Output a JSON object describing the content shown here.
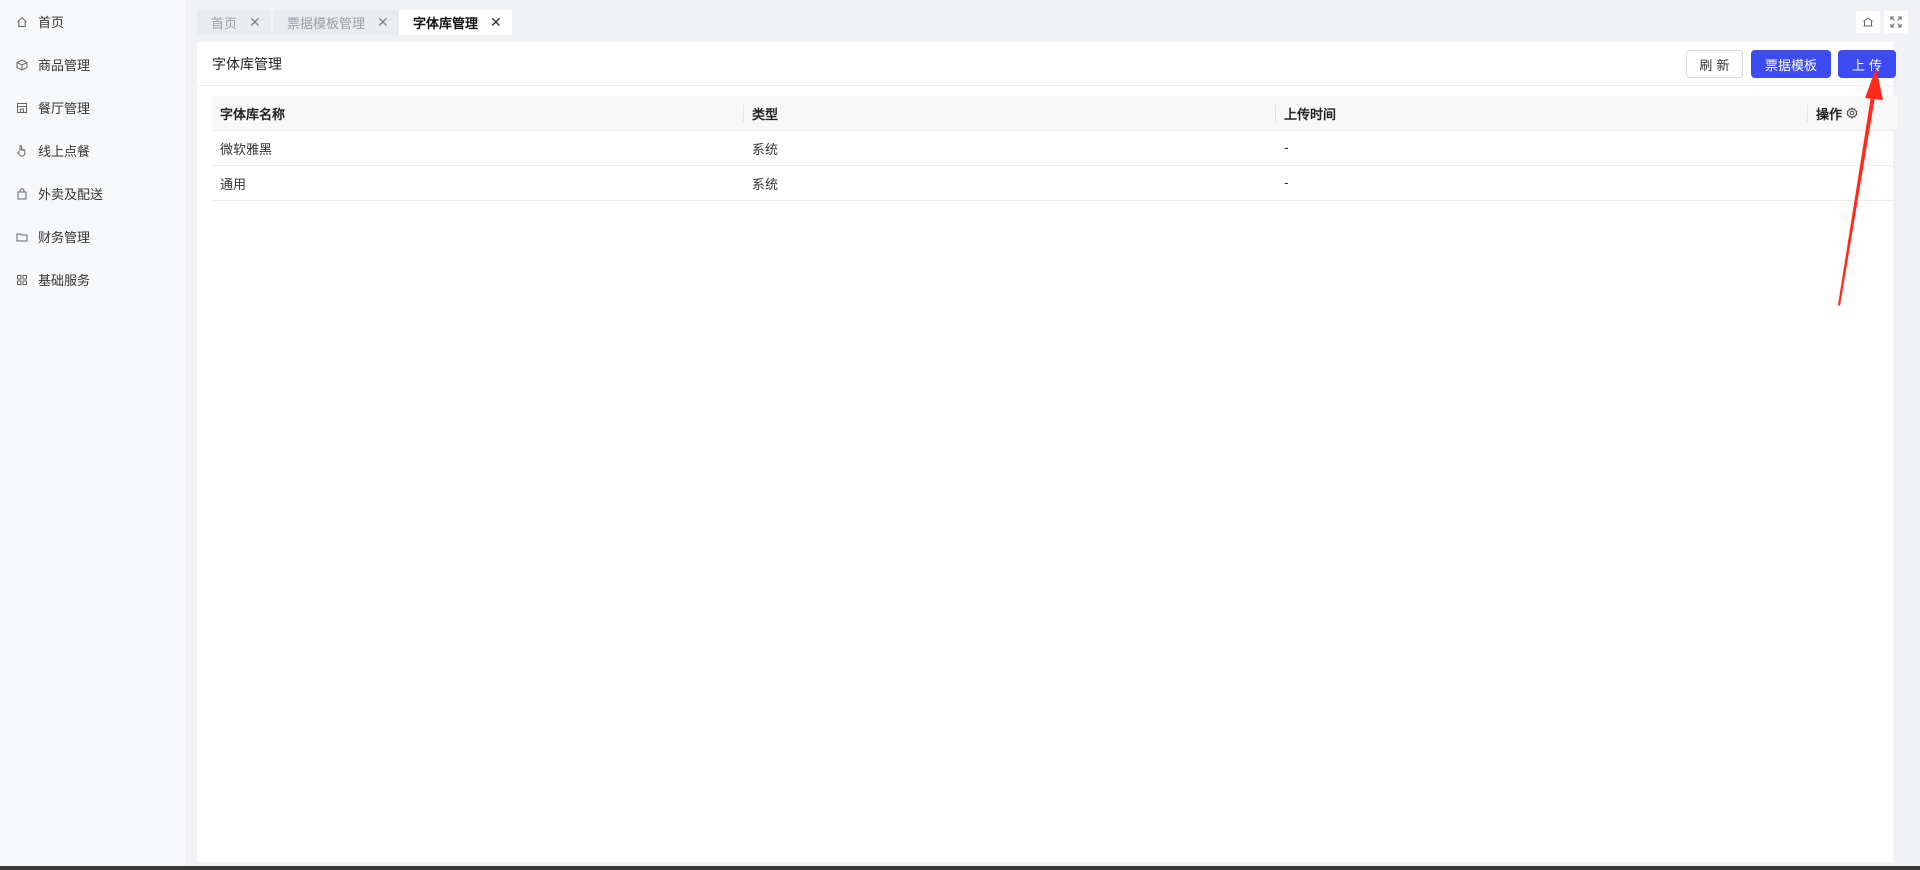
{
  "sidebar": {
    "items": [
      {
        "label": "首页",
        "icon": "home-icon"
      },
      {
        "label": "商品管理",
        "icon": "box-icon"
      },
      {
        "label": "餐厅管理",
        "icon": "store-icon"
      },
      {
        "label": "线上点餐",
        "icon": "hand-pointer-icon"
      },
      {
        "label": "外卖及配送",
        "icon": "shopping-bag-icon"
      },
      {
        "label": "财务管理",
        "icon": "folder-icon"
      },
      {
        "label": "基础服务",
        "icon": "grid-icon"
      }
    ]
  },
  "tabs": [
    {
      "label": "首页",
      "active": false
    },
    {
      "label": "票据模板管理",
      "active": false
    },
    {
      "label": "字体库管理",
      "active": true
    }
  ],
  "panel": {
    "title": "字体库管理",
    "buttons": {
      "refresh": "刷 新",
      "templates": "票据模板",
      "upload": "上 传"
    }
  },
  "table": {
    "columns": [
      "字体库名称",
      "类型",
      "上传时间",
      "操作"
    ],
    "rows": [
      {
        "name": "微软雅黑",
        "type": "系统",
        "time": "-"
      },
      {
        "name": "通用",
        "type": "系统",
        "time": "-"
      }
    ]
  },
  "colors": {
    "primary": "#3d4bf2",
    "annotation": "#ff2a1a"
  }
}
